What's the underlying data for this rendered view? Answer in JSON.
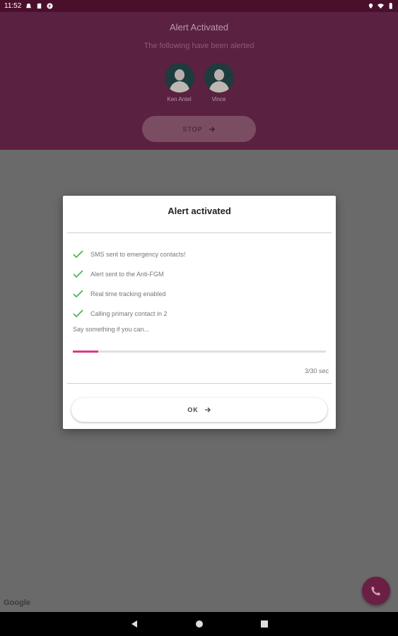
{
  "status_bar": {
    "time": "11:52",
    "left_icons": [
      "notification-icon",
      "sd-card-icon",
      "app-badge-icon"
    ],
    "right_icons": [
      "location-icon",
      "wifi-icon",
      "battery-icon"
    ]
  },
  "header": {
    "title": "Alert Activated",
    "subtitle": "The following have been alerted",
    "contacts": [
      {
        "name": "Ken Antel"
      },
      {
        "name": "Vince"
      }
    ],
    "stop_label": "STOP"
  },
  "dialog": {
    "title": "Alert activated",
    "checks": [
      {
        "text": "SMS sent to emergency contacts!"
      },
      {
        "text": "Alert sent to the Anti-FGM"
      },
      {
        "text": "Real time tracking enabled"
      },
      {
        "text": "Calling primary contact in 2"
      }
    ],
    "prompt": "Say something if you can...",
    "progress_fraction": 0.1,
    "timer": "3/30 sec",
    "ok_label": "OK"
  },
  "map": {
    "attribution": "Google"
  },
  "colors": {
    "header_bg": "#5a2140",
    "accent": "#d93a88",
    "check": "#4caf50",
    "fab_bg": "#6b1f43"
  }
}
